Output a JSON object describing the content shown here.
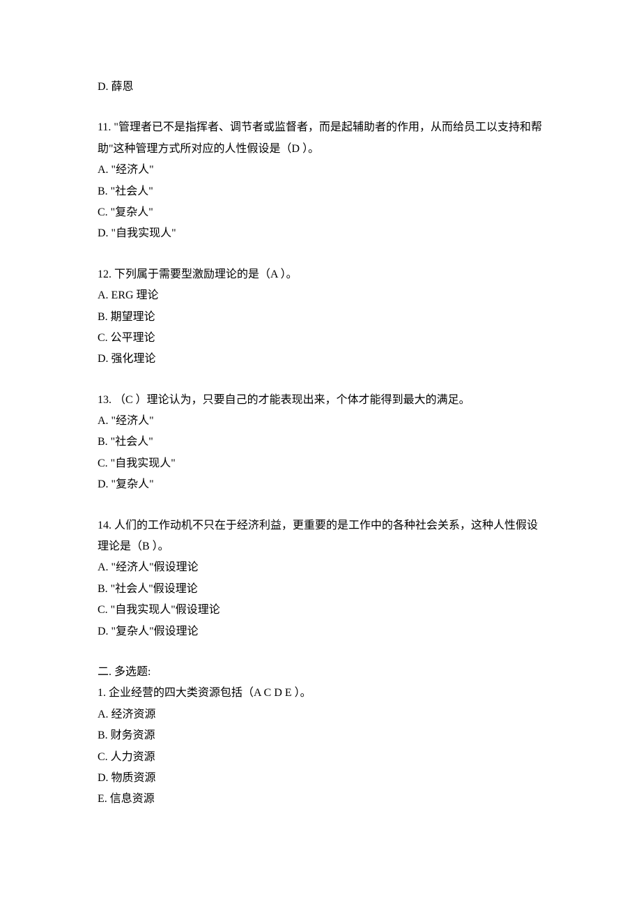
{
  "blocks": [
    {
      "lines": [
        "D. 薛恩"
      ]
    },
    {
      "lines": [
        "11. \"管理者已不是指挥者、调节者或监督者，而是起辅助者的作用，从而给员工以支持和帮助\"这种管理方式所对应的人性假设是（D ）。",
        "A. \"经济人\"",
        "B. \"社会人\"",
        "C. \"复杂人\"",
        "D. \"自我实现人\""
      ]
    },
    {
      "lines": [
        "12. 下列属于需要型激励理论的是（A ）。",
        "A. ERG 理论",
        "B. 期望理论",
        "C. 公平理论",
        "D. 强化理论"
      ]
    },
    {
      "lines": [
        "13. （C ）理论认为，只要自己的才能表现出来，个体才能得到最大的满足。",
        "A. \"经济人\"",
        "B. \"社会人\"",
        "C. \"自我实现人\"",
        "D. \"复杂人\""
      ]
    },
    {
      "lines": [
        "14. 人们的工作动机不只在于经济利益，更重要的是工作中的各种社会关系，这种人性假设理论是（B ）。",
        "A. \"经济人\"假设理论",
        "B. \"社会人\"假设理论",
        "C. \"自我实现人\"假设理论",
        "D. \"复杂人\"假设理论"
      ]
    },
    {
      "lines": [
        "二. 多选题:",
        "1. 企业经营的四大类资源包括（A C D E ）。",
        "A. 经济资源",
        "B. 财务资源",
        "C. 人力资源",
        "D. 物质资源",
        "E. 信息资源"
      ]
    }
  ]
}
